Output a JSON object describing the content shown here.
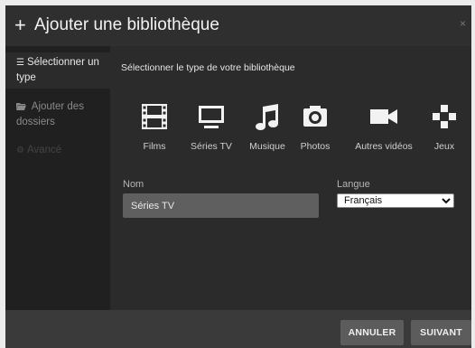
{
  "dialog": {
    "title_icon": "plus-icon",
    "title": "Ajouter une bibliothèque",
    "close_glyph": "×"
  },
  "sidebar": {
    "items": [
      {
        "icon": "list-icon",
        "label": "Sélectionner un type",
        "state": "active"
      },
      {
        "icon": "folder-open-icon",
        "label": "Ajouter des dossiers",
        "state": "normal"
      },
      {
        "icon": "gear-icon",
        "label": "Avancé",
        "state": "disabled"
      }
    ]
  },
  "main": {
    "subheading": "Sélectionner le type de votre bibliothèque",
    "types": [
      {
        "icon": "film-icon",
        "label": "Films"
      },
      {
        "icon": "tv-icon",
        "label": "Séries TV"
      },
      {
        "icon": "music-note-icon",
        "label": "Musique"
      },
      {
        "icon": "camera-icon",
        "label": "Photos"
      },
      {
        "icon": "video-camera-icon",
        "label": "Autres vidéos"
      },
      {
        "icon": "gamepad-icon",
        "label": "Jeux"
      }
    ],
    "name_field": {
      "label": "Nom",
      "value": "Séries TV"
    },
    "language_field": {
      "label": "Langue",
      "selected": "Français"
    }
  },
  "footer": {
    "cancel_label": "ANNULER",
    "next_label": "SUIVANT"
  },
  "colors": {
    "background": "#2b2b2b",
    "sidebar": "#202020",
    "footer": "#3a3a3a",
    "button": "#5c5c5c",
    "icon": "#f2f2f2"
  }
}
